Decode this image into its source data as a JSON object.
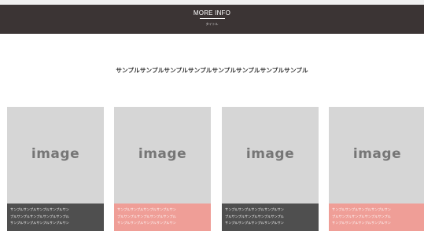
{
  "header": {
    "title": "MORE INFO",
    "subtitle": "タイトル",
    "background": "#3b3434"
  },
  "lead_text": "サンプルサンプルサンプルサンプルサンプルサンプルサンプルサンプル",
  "cards": [
    {
      "image_label": "image",
      "caption_lines": [
        "サンプルサンプルサンプルサンプルサン",
        "プルサンプルサンプルサンプルサンプル",
        "サンプルサンプルサンプルサンプルサン"
      ],
      "caption_color": "#4f4f4f"
    },
    {
      "image_label": "image",
      "caption_lines": [
        "サンプルサンプルサンプルサンプルサン",
        "プルサンプルサンプルサンプルサンプル",
        "サンプルサンプルサンプルサンプルサン"
      ],
      "caption_color": "#ef9e97"
    },
    {
      "image_label": "image",
      "caption_lines": [
        "サンプルサンプルサンプルサンプルサン",
        "プルサンプルサンプルサンプルサンプル",
        "サンプルサンプルサンプルサンプルサン"
      ],
      "caption_color": "#4f4f4f"
    },
    {
      "image_label": "image",
      "caption_lines": [
        "サンプルサンプルサンプルサンプルサン",
        "プルサンプルサンプルサンプルサンプル",
        "サンプルサンプルサンプルサンプルサン"
      ],
      "caption_color": "#ef9e97"
    }
  ]
}
